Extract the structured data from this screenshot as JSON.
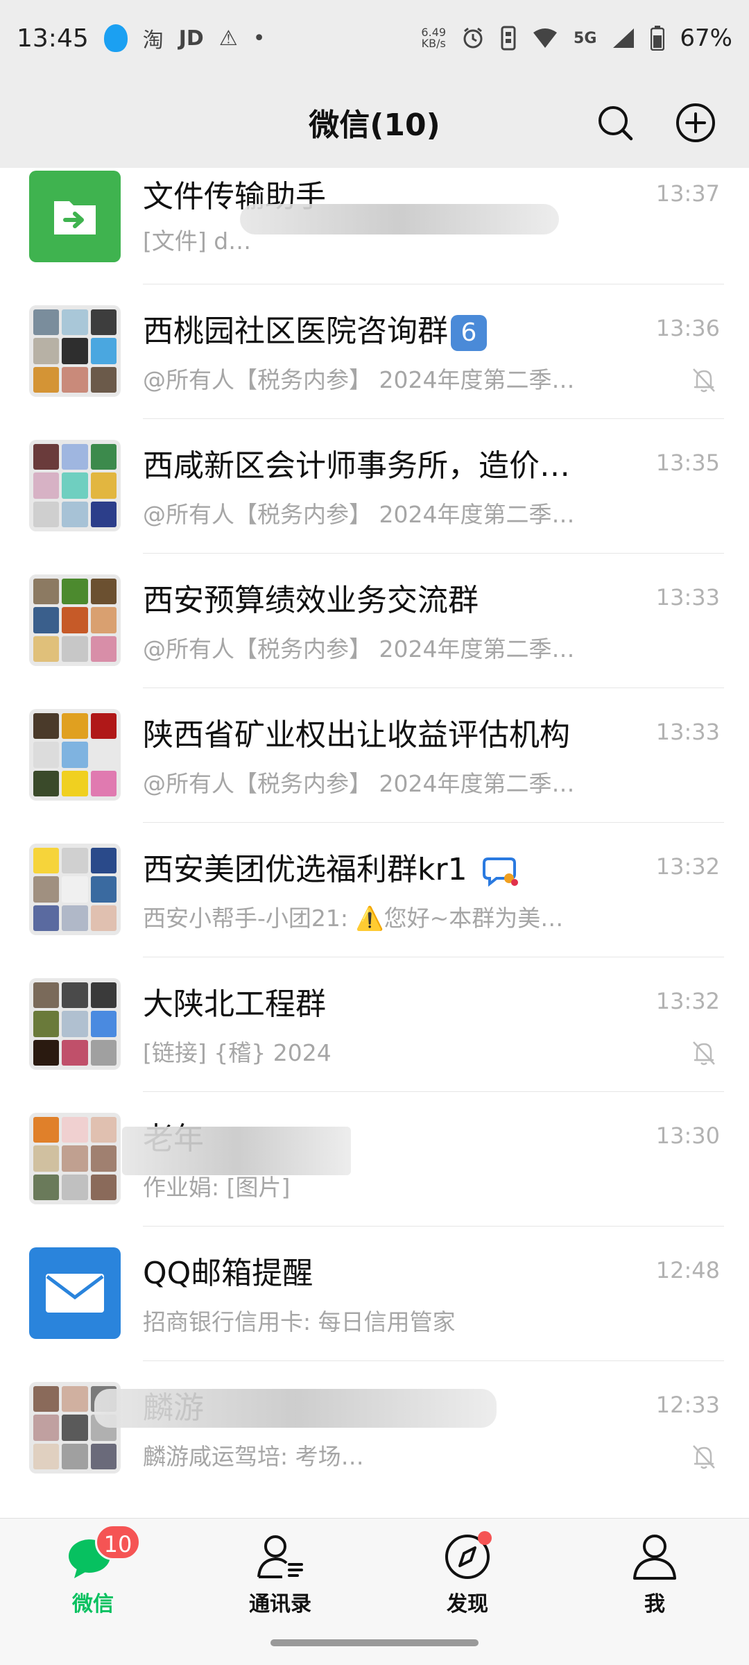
{
  "status_bar": {
    "time": "13:45",
    "app_icons": [
      "qq-icon",
      "淘",
      "JD",
      "⚠",
      "•"
    ],
    "net_speed_value": "6.49",
    "net_speed_unit": "KB/s",
    "network": "5G",
    "battery": "67%"
  },
  "header": {
    "title": "微信(10)"
  },
  "chats": [
    {
      "title": "文件传输助手",
      "preview": "[文件] d…",
      "time": "13:37",
      "muted": false
    },
    {
      "title": "西桃园社区医院咨询群",
      "badge": "6",
      "preview": "@所有人【税务内参】 2024年度第二季…",
      "time": "13:36",
      "muted": true
    },
    {
      "title": "西咸新区会计师事务所，造价…",
      "preview": "@所有人【税务内参】 2024年度第二季…",
      "time": "13:35",
      "muted": false
    },
    {
      "title": "西安预算绩效业务交流群",
      "preview": "@所有人【税务内参】 2024年度第二季…",
      "time": "13:33",
      "muted": false
    },
    {
      "title": "陕西省矿业权出让收益评估机构",
      "preview": "@所有人【税务内参】 2024年度第二季…",
      "time": "13:33",
      "muted": false
    },
    {
      "title": "西安美团优选福利群kr1",
      "preview": "西安小帮手-小团21: ⚠️您好~本群为美…",
      "time": "13:32",
      "muted": false
    },
    {
      "title": "大陕北工程群",
      "preview": "[链接] {稽} 2024",
      "time": "13:32",
      "muted": true
    },
    {
      "title": "老年",
      "preview": "作业娟: [图片]",
      "time": "13:30",
      "muted": false
    },
    {
      "title": "QQ邮箱提醒",
      "preview": "招商银行信用卡: 每日信用管家",
      "time": "12:48",
      "muted": false
    },
    {
      "title": "麟游",
      "preview": "麟游咸运驾培:                   考场…",
      "time": "12:33",
      "muted": true
    }
  ],
  "tabs": [
    {
      "label": "微信",
      "badge": "10",
      "active": true
    },
    {
      "label": "通讯录"
    },
    {
      "label": "发现"
    },
    {
      "label": "我"
    }
  ],
  "colors": {
    "accent": "#07c160",
    "badge": "#f55454",
    "header_bg": "#ededed"
  }
}
